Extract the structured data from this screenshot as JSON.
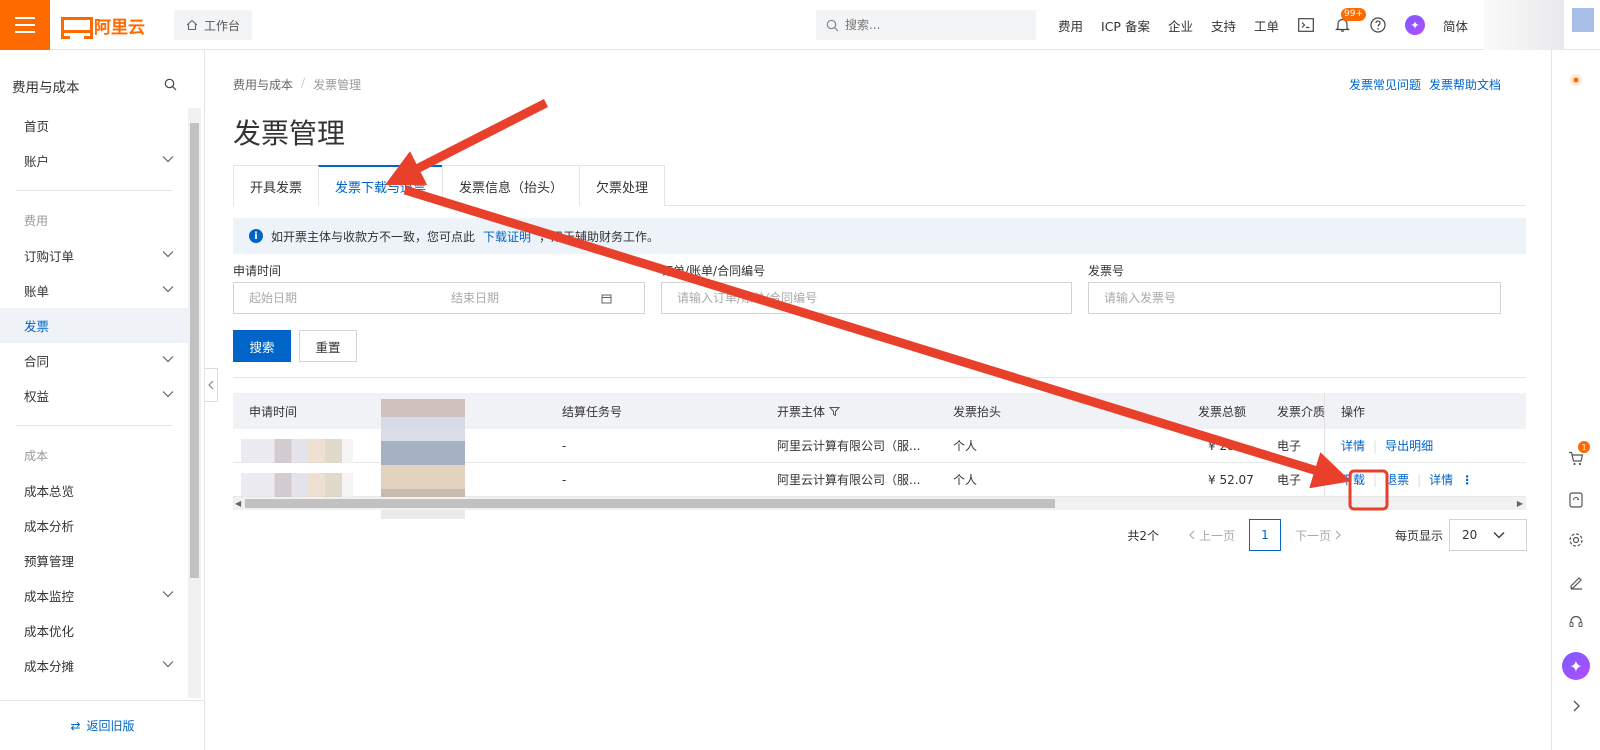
{
  "topbar": {
    "logo_text": "阿里云",
    "workbench_label": "工作台",
    "search_placeholder": "搜索...",
    "nav": [
      "费用",
      "ICP 备案",
      "企业",
      "支持",
      "工单"
    ],
    "bell_badge": "99+",
    "lang_label": "简体"
  },
  "sidebar": {
    "title": "费用与成本",
    "items": {
      "home": "首页",
      "account": "账户",
      "group_fee": "费用",
      "orders": "订购订单",
      "bills": "账单",
      "invoice": "发票",
      "contract": "合同",
      "rights": "权益",
      "group_cost": "成本",
      "cost_overview": "成本总览",
      "cost_analysis": "成本分析",
      "budget": "预算管理",
      "cost_monitor": "成本监控",
      "cost_optimize": "成本优化",
      "cost_split": "成本分摊"
    },
    "back_old": "返回旧版"
  },
  "breadcrumb": {
    "parent": "费用与成本",
    "current": "发票管理"
  },
  "help": {
    "faq": "发票常见问题",
    "doc": "发票帮助文档"
  },
  "page_title": "发票管理",
  "tabs": [
    "开具发票",
    "发票下载与退票",
    "发票信息（抬头）",
    "欠票处理"
  ],
  "notice": {
    "text_before": "如开票主体与收款方不一致，您可点此",
    "link": "下载证明",
    "text_after": "，用于辅助财务工作。"
  },
  "filters": {
    "date_label": "申请时间",
    "start_placeholder": "起始日期",
    "end_placeholder": "结束日期",
    "order_label": "订单/账单/合同编号",
    "order_placeholder": "请输入订单/账单/合同编号",
    "invoice_label": "发票号",
    "invoice_placeholder": "请输入发票号",
    "search_btn": "搜索",
    "reset_btn": "重置"
  },
  "table": {
    "headers": {
      "apply_time": "申请时间",
      "task_no": "结算任务号",
      "entity": "开票主体",
      "title": "发票抬头",
      "amount": "发票总额",
      "medium": "发票介质",
      "ops": "操作"
    },
    "rows": [
      {
        "task_no": "-",
        "entity": "阿里云计算有限公司（服...",
        "title": "个人",
        "amount": "¥ 28.",
        "medium": "电子",
        "ops": [
          "详情",
          "导出明细"
        ]
      },
      {
        "task_no": "-",
        "entity": "阿里云计算有限公司（服...",
        "title": "个人",
        "amount": "¥ 52.07",
        "medium": "电子",
        "ops": [
          "下载",
          "退票",
          "详情"
        ]
      }
    ]
  },
  "pager": {
    "total": "共2个",
    "prev": "上一页",
    "current": "1",
    "next": "下一页",
    "per_page_label": "每页显示",
    "per_page": "20"
  },
  "rightbar": {
    "cart_badge": "1"
  },
  "colors": {
    "brand": "#ff6a00",
    "primary": "#0064c8",
    "annotation": "#e8402a"
  }
}
